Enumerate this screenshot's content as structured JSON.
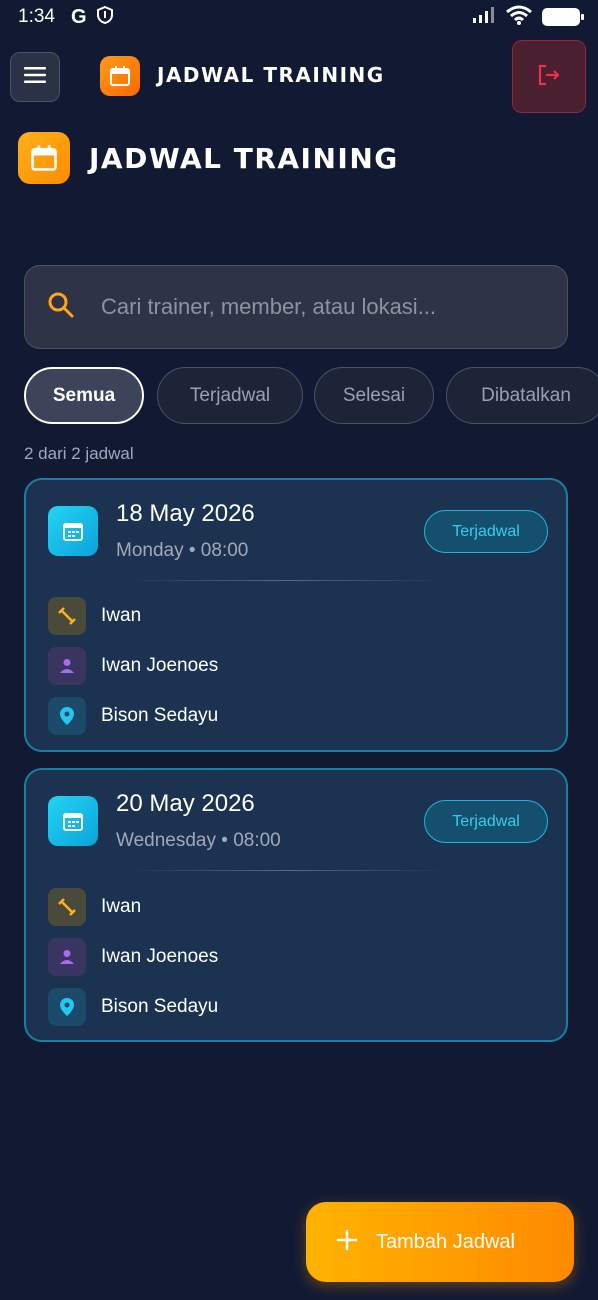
{
  "status_bar": {
    "time": "1:34",
    "app_icons": [
      "G",
      "shield-icon"
    ]
  },
  "app_bar": {
    "title": "JADWAL TRAINING"
  },
  "page": {
    "title": "JADWAL TRAINING"
  },
  "search": {
    "placeholder": "Cari trainer, member, atau lokasi..."
  },
  "filters": [
    {
      "label": "Semua",
      "active": true
    },
    {
      "label": "Terjadwal",
      "active": false
    },
    {
      "label": "Selesai",
      "active": false
    },
    {
      "label": "Dibatalkan",
      "active": false
    }
  ],
  "result_count": "2 dari 2 jadwal",
  "schedules": [
    {
      "date": "18 May 2026",
      "day_time": "Monday • 08:00",
      "status": "Terjadwal",
      "trainer": "Iwan",
      "member": "Iwan Joenoes",
      "location": "Bison Sedayu"
    },
    {
      "date": "20 May 2026",
      "day_time": "Wednesday • 08:00",
      "status": "Terjadwal",
      "trainer": "Iwan",
      "member": "Iwan Joenoes",
      "location": "Bison Sedayu"
    }
  ],
  "fab": {
    "label": "Tambah Jadwal"
  },
  "colors": {
    "background": "#121a33",
    "accent_orange": "#ff8c00",
    "accent_cyan": "#1fb5d8",
    "logout_red": "#e8334a"
  }
}
